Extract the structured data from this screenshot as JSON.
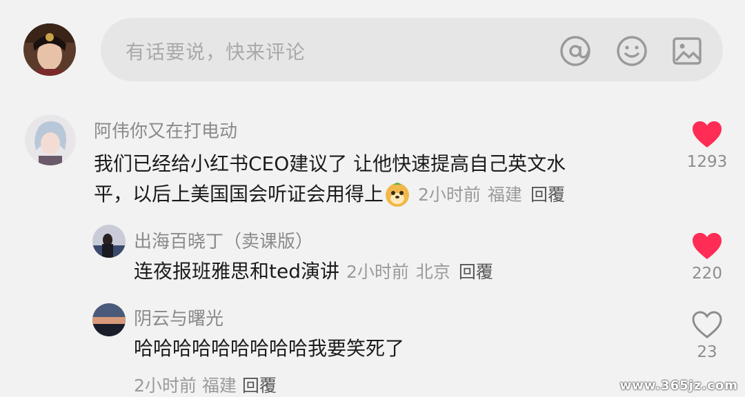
{
  "composer": {
    "placeholder": "有话要说，快来评论",
    "icons": [
      "at-icon",
      "emoji-icon",
      "image-icon"
    ]
  },
  "comments": [
    {
      "author": "阿伟你又在打电动",
      "text_line1": "我们已经给小红书CEO建议了 让他快速提高自己英文水",
      "text_line2": "平，以后上美国国会听证会用得上",
      "time": "2小时前",
      "location": "福建",
      "reply": "回覆",
      "likes": "1293",
      "liked": true
    },
    {
      "author": "出海百晓丁（卖课版）",
      "text": "连夜报班雅思和ted演讲",
      "time": "2小时前",
      "location": "北京",
      "reply": "回覆",
      "likes": "220",
      "liked": true
    },
    {
      "author": "阴云与曙光",
      "text": "哈哈哈哈哈哈哈哈哈我要笑死了",
      "time": "2小时前",
      "location": "福建",
      "reply": "回覆",
      "likes": "23",
      "liked": false
    }
  ],
  "colors": {
    "like_red": "#ff2d55",
    "background": "#f2f2f2",
    "input_bg": "#e6e6e6"
  },
  "watermark": "www.365jz.com"
}
